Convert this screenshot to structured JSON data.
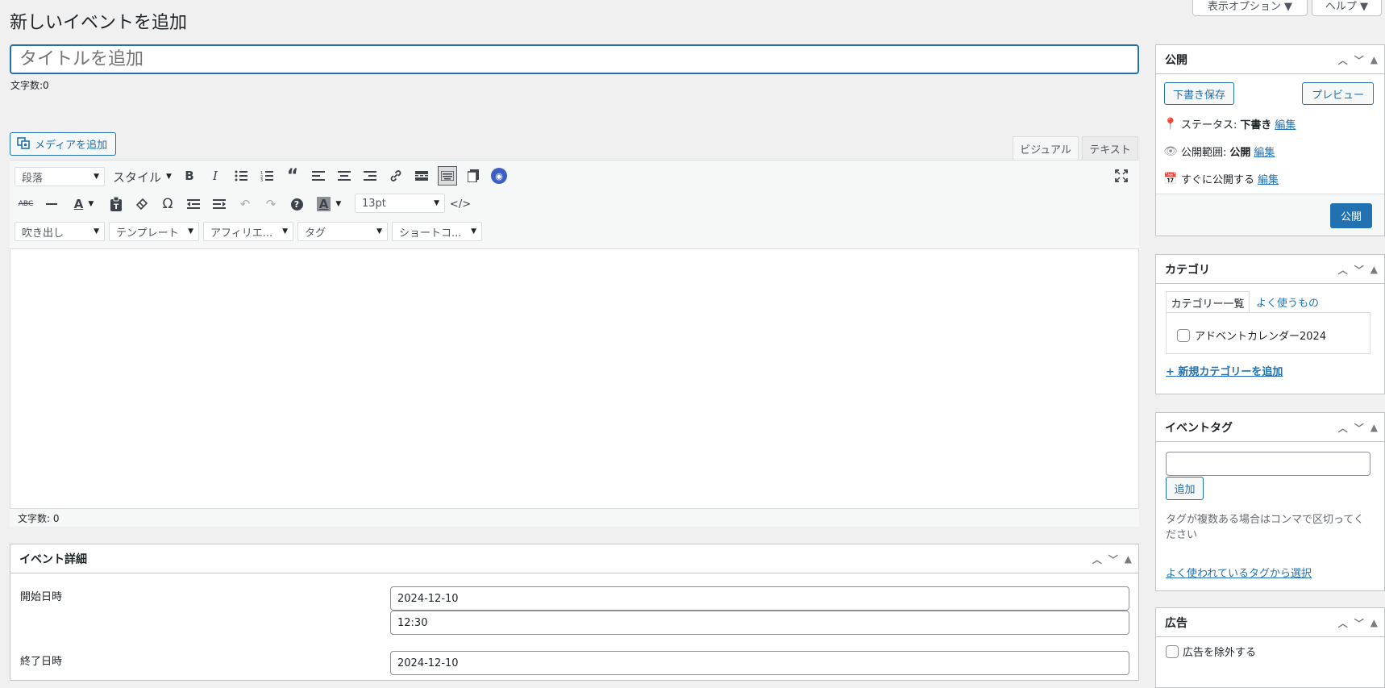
{
  "page": {
    "title": "新しいイベントを追加",
    "screen_options_label": "表示オプション ▼",
    "help_label": "ヘルプ ▼"
  },
  "title_field": {
    "placeholder": "タイトルを追加",
    "char_count_label": "文字数:0"
  },
  "editor": {
    "add_media_label": "メディアを追加",
    "tabs": [
      "ビジュアル",
      "テキスト"
    ],
    "active_tab": "ビジュアル",
    "format_select": "段落",
    "style_select": "スタイル",
    "font_size_select": "13pt",
    "row3_selects": [
      "吹き出し",
      "テンプレート",
      "アフィリエ...",
      "タグ",
      "ショートコ..."
    ],
    "status_word_count": "文字数: 0",
    "icons_row1": [
      "bold-icon",
      "italic-icon",
      "bullet-list-icon",
      "numbered-list-icon",
      "blockquote-icon",
      "align-left-icon",
      "align-center-icon",
      "align-right-icon",
      "link-icon",
      "read-more-icon",
      "toolbar-toggle-icon",
      "copy-icon",
      "wifi-icon"
    ],
    "icons_row2": [
      "strikethrough-icon",
      "horizontal-line-icon",
      "text-color-icon",
      "paste-text-icon",
      "clear-format-icon",
      "special-char-icon",
      "outdent-icon",
      "indent-icon",
      "undo-icon",
      "redo-icon",
      "help-icon",
      "bg-color-icon",
      "code-icon"
    ]
  },
  "event_details": {
    "title": "イベント詳細",
    "start_label": "開始日時",
    "start_date": "2024-12-10",
    "start_time": "12:30",
    "end_label": "終了日時",
    "end_date": "2024-12-10"
  },
  "publish_box": {
    "title": "公開",
    "save_draft_label": "下書き保存",
    "preview_label": "プレビュー",
    "status_label": "ステータス:",
    "status_value": "下書き",
    "visibility_label": "公開範囲:",
    "visibility_value": "公開",
    "schedule_label": "すぐに公開する",
    "edit_label": "編集",
    "publish_label": "公開"
  },
  "category_box": {
    "title": "カテゴリ",
    "tab_all": "カテゴリー一覧",
    "tab_popular": "よく使うもの",
    "categories": [
      "アドベントカレンダー2024"
    ],
    "add_new_label": "+ 新規カテゴリーを追加"
  },
  "tag_box": {
    "title": "イベントタグ",
    "add_label": "追加",
    "help_text": "タグが複数ある場合はコンマで区切ってください",
    "popular_link": "よく使われているタグから選択"
  },
  "ad_box": {
    "title": "広告",
    "exclude_label": "広告を除外する"
  },
  "colors": {
    "accent": "#2271b1",
    "background": "#f0f0f1"
  }
}
